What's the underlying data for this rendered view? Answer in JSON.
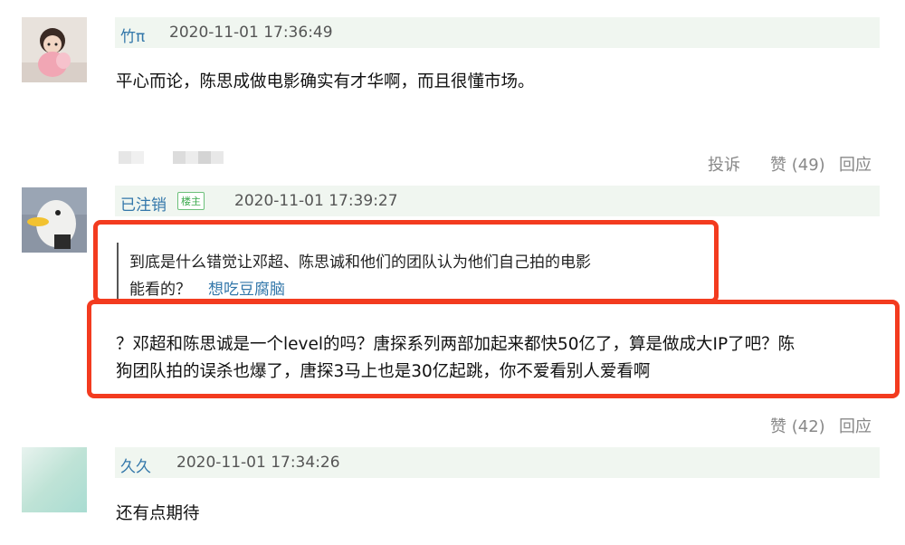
{
  "colors": {
    "link": "#3377aa",
    "header_bg": "#f0f6f0",
    "highlight": "#f33b1f",
    "badge": "#3ba94d",
    "muted": "#888888"
  },
  "comments": [
    {
      "username": "竹π",
      "time": "2020-11-01 17:36:49",
      "text": "平心而论，陈思成做电影确实有才华啊，而且很懂市场。",
      "actions": {
        "report": "投诉",
        "like": "赞 (49)",
        "reply": "回应"
      }
    },
    {
      "username": "已注销",
      "badge": "楼主",
      "time": "2020-11-01 17:39:27",
      "quote": {
        "line1": "到底是什么错觉让邓超、陈思诚和他们的团队认为他们自己拍的电影",
        "line2": "能看的？",
        "author": "想吃豆腐脑"
      },
      "text_line1": "？邓超和陈思诚是一个level的吗？唐探系列两部加起来都快50亿了，算是做成大IP了吧？陈",
      "text_line2": "狗团队拍的误杀也爆了，唐探3马上也是30亿起跳，你不爱看别人爱看啊",
      "actions": {
        "like": "赞 (42)",
        "reply": "回应"
      }
    },
    {
      "username": "久久",
      "time": "2020-11-01 17:34:26",
      "text": "还有点期待"
    }
  ]
}
